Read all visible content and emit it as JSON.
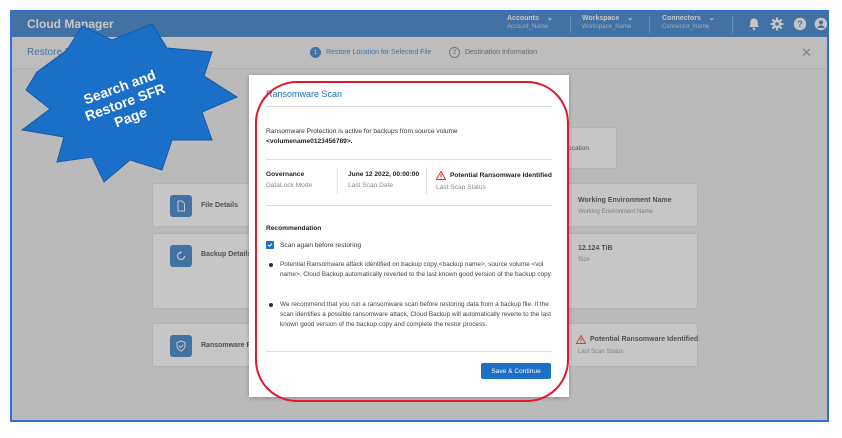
{
  "topbar": {
    "app_title": "Cloud Manager",
    "accounts": {
      "label": "Accounts",
      "value": "Account_Name"
    },
    "workspace": {
      "label": "Workspace",
      "value": "Workspace_Name"
    },
    "connectors": {
      "label": "Connectors",
      "value": "Connector_Name"
    },
    "icons": [
      "bell-icon",
      "gear-icon",
      "help-icon",
      "user-icon"
    ],
    "bg_color": "#1c6fc4"
  },
  "subheader": {
    "page_title": "Restore File",
    "steps": [
      {
        "num": "1",
        "label": "Restore Location for Selected File"
      },
      {
        "num": "2",
        "label": "Destination Information"
      }
    ],
    "close": "✕"
  },
  "background": {
    "location_fragment": "ocation",
    "cards": [
      {
        "label": "File Details",
        "right_title": "Working Environment Name",
        "right_sub": "Working Environment Name"
      },
      {
        "label": "Backup Details",
        "right_title": "12.124 TiB",
        "right_sub": "Size"
      },
      {
        "label": "Ransomware Pr",
        "right_title": "Potential Ransomware Identified",
        "right_sub": "Last Scan Status"
      }
    ]
  },
  "modal": {
    "title": "Ransomware Scan",
    "intro_text": "Ransomware Protection is active for backups from source volume",
    "volume": "<volumename0123456789>.",
    "fields": [
      {
        "key": "Governance",
        "value": "DataLock Mode"
      },
      {
        "key": "June 12 2022, 00:00:00",
        "value": "Last Scan Date"
      },
      {
        "key": "Potential Ransomware Identified",
        "value": "Last Scan Status"
      }
    ],
    "recommendation_title": "Recommendation",
    "checkbox_label": "Scan again before restoring",
    "bullets": [
      "Potential Ransomware attack identified on backup copy <backup name>, source volume <vol name>. Cloud Backup automatically reverted to the last known good version of the backup copy.",
      "We recommend that you run a ransomware scan before restoring data from a backup file. If the scan identifies a possible ransomware attack, Cloud Backup will automatically reverte to the last known good version of the backup copy and complete the restor process."
    ],
    "button_label": "Save & Continue"
  },
  "annotation": {
    "text": "Search and Restore SFR Page",
    "burst_color": "#1a6fc8",
    "oval_color": "#e0192d"
  }
}
